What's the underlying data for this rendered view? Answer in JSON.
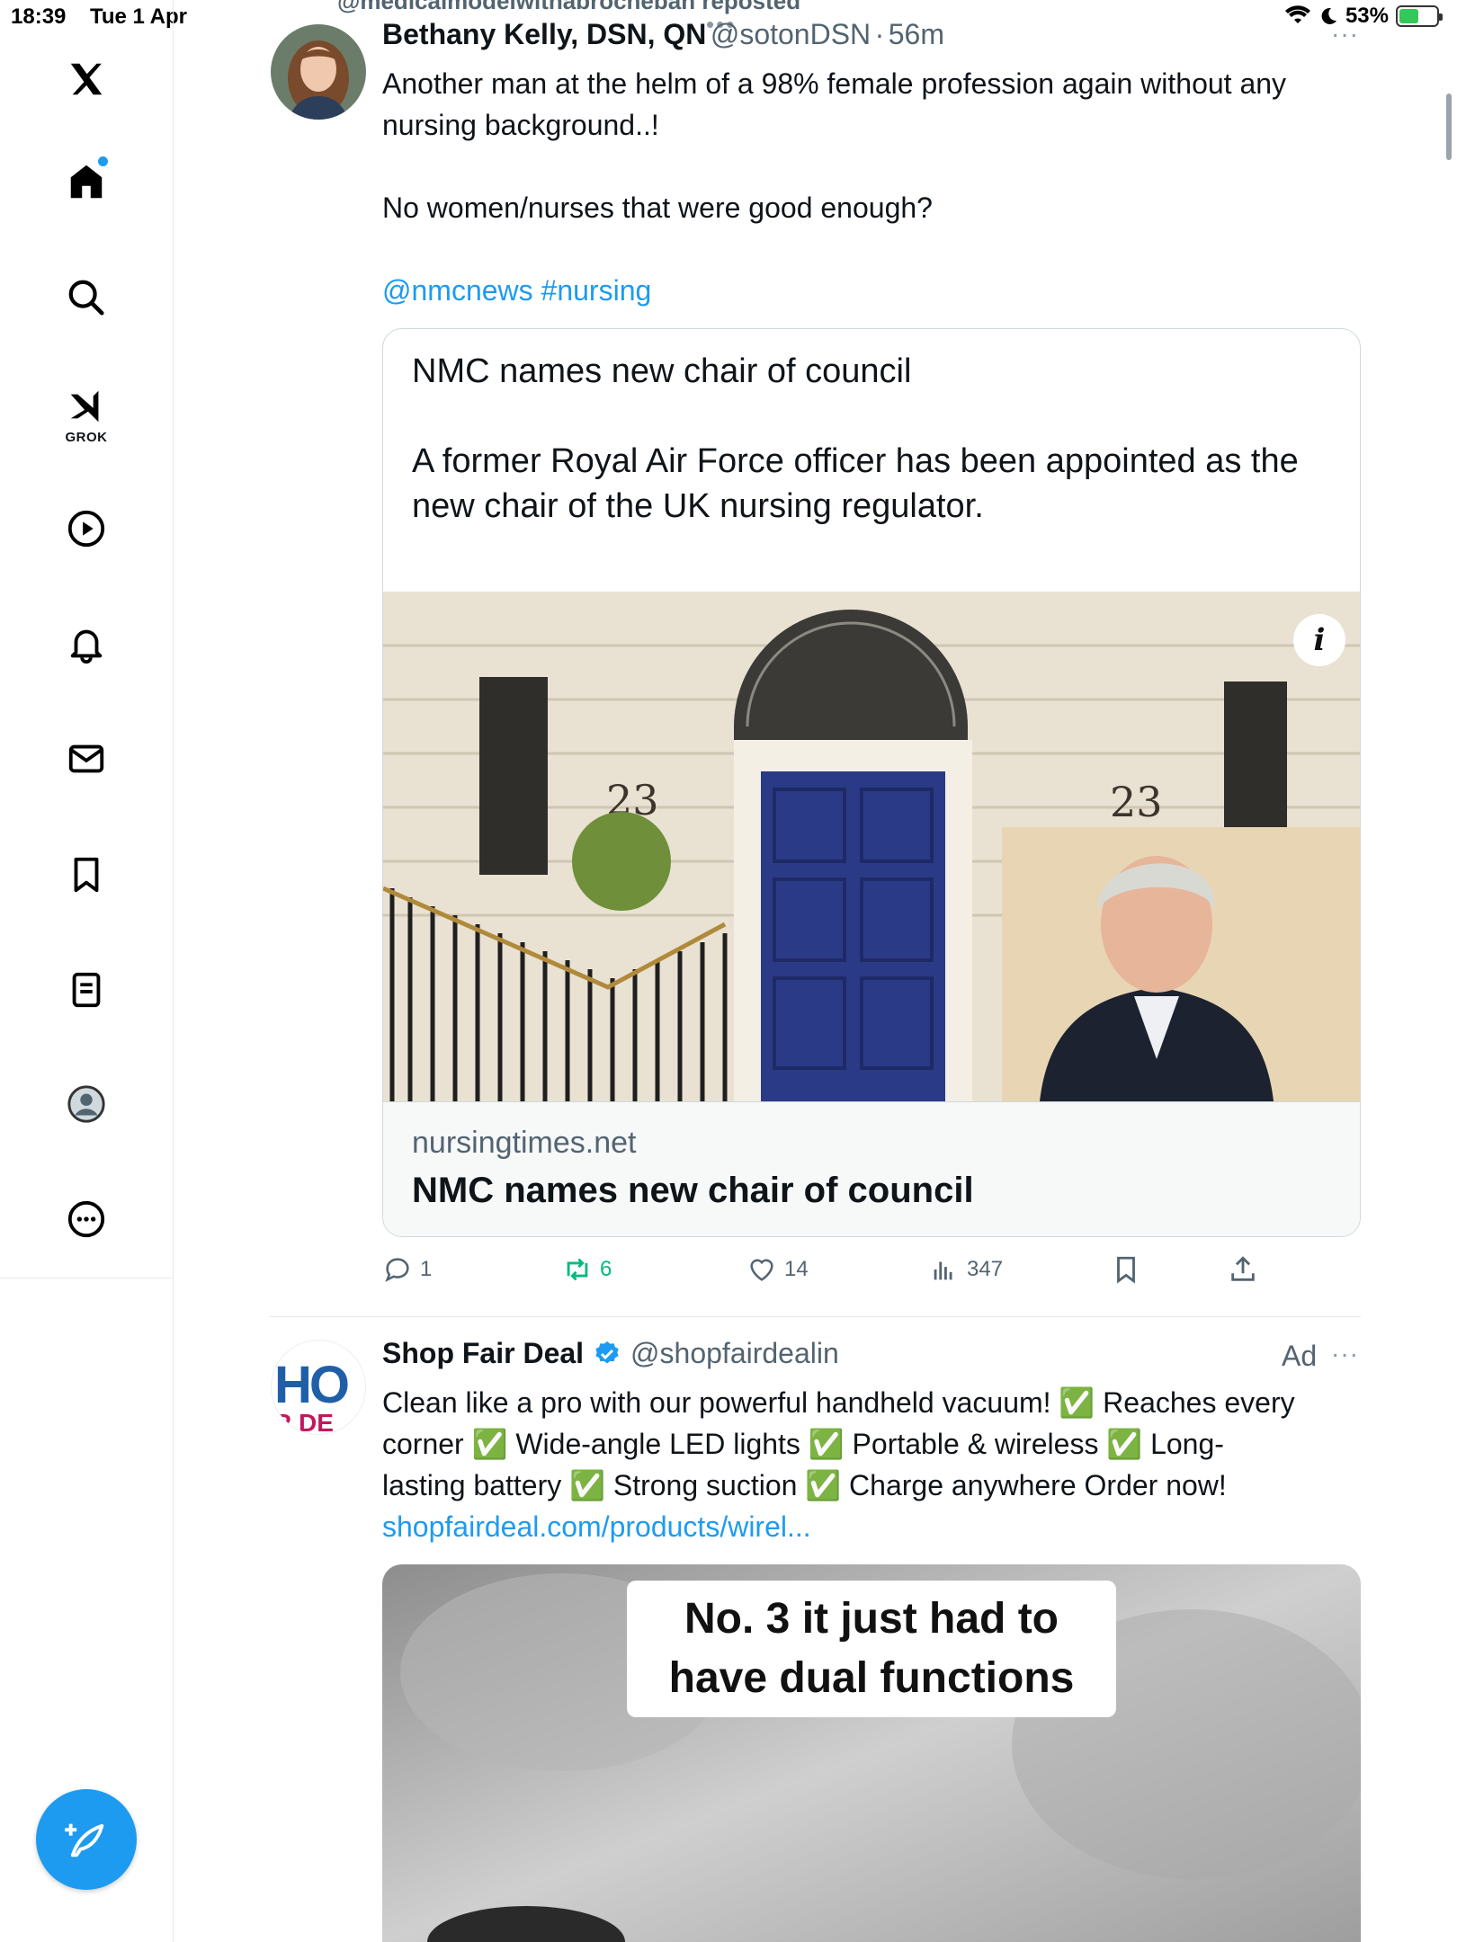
{
  "status_bar": {
    "time": "18:39",
    "date": "Tue 1 Apr",
    "battery": "53%",
    "battery_level": 0.53
  },
  "sidebar": {
    "grok_label": "GROK",
    "compose_label": "Post",
    "items": [
      {
        "name": "x-logo-icon"
      },
      {
        "name": "home-icon"
      },
      {
        "name": "search-icon"
      },
      {
        "name": "grok-icon"
      },
      {
        "name": "video-icon"
      },
      {
        "name": "notifications-icon"
      },
      {
        "name": "messages-icon"
      },
      {
        "name": "bookmarks-icon"
      },
      {
        "name": "lists-icon"
      },
      {
        "name": "profile-icon"
      },
      {
        "name": "more-icon"
      }
    ]
  },
  "feed": {
    "repost_banner": "@medicalmodelwithabrocheban reposted",
    "tweet1": {
      "name": "Bethany Kelly, DSN, QN",
      "handle": "@sotonDSN",
      "time": "56m",
      "text_line1": "Another man at the helm of a 98% female profession again without any",
      "text_line2": "nursing background..!",
      "text_para2": "No women/nurses that were good enough?",
      "mention": "@nmcnews",
      "hashtag": "#nursing",
      "card": {
        "headline": "NMC names new chair of council",
        "summary": "A former Royal Air Force officer has been appointed as the new chair of the UK nursing regulator.",
        "image_numbers": "23",
        "info_badge": "i",
        "domain": "nursingtimes.net",
        "title": "NMC names new chair of council"
      },
      "actions": {
        "replies": "1",
        "reposts": "6",
        "likes": "14",
        "views": "347"
      }
    },
    "tweet2": {
      "name": "Shop Fair Deal",
      "handle": "@shopfairdealin",
      "ad_label": "Ad",
      "avatar_text_top": "HO",
      "avatar_text_bottom": "R DE",
      "text_line1": "Clean like a pro with our powerful handheld vacuum! ✅ Reaches every",
      "text_line2": "corner ✅ Wide-angle LED lights ✅ Portable & wireless ✅ Long-",
      "text_line3": "lasting battery ✅ Strong suction ✅ Charge anywhere Order now!",
      "link": "shopfairdeal.com/products/wirel...",
      "video_caption_line1": "No. 3 it just had to",
      "video_caption_line2": "have dual functions"
    }
  },
  "colors": {
    "accent": "#1d9bf0",
    "repost_green": "#00ba7c",
    "text": "#0f1419",
    "muted": "#536471",
    "door_blue": "#2b3a86"
  }
}
